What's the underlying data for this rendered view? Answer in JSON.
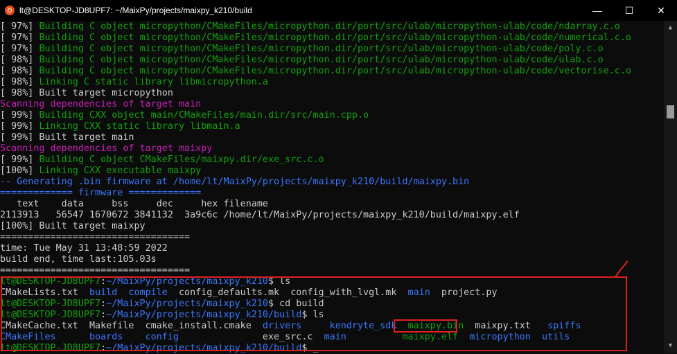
{
  "window": {
    "title": "lt@DESKTOP-JD8UPF7: ~/MaixPy/projects/maixpy_k210/build",
    "minimize": "—",
    "maximize": "☐",
    "close": "✕"
  },
  "colors": {
    "green": "#13a10e",
    "magenta": "#c71fb6",
    "blue": "#3b78ff",
    "white": "#cccccc",
    "highlight": "#e0201c"
  },
  "lines": [
    [
      {
        "t": "[ 97%] ",
        "c": "w"
      },
      {
        "t": "Building C object micropython/CMakeFiles/micropython.dir/port/src/ulab/micropython-ulab/code/ndarray.c.o",
        "c": "g"
      }
    ],
    [
      {
        "t": "[ 97%] ",
        "c": "w"
      },
      {
        "t": "Building C object micropython/CMakeFiles/micropython.dir/port/src/ulab/micropython-ulab/code/numerical.c.o",
        "c": "g"
      }
    ],
    [
      {
        "t": "[ 97%] ",
        "c": "w"
      },
      {
        "t": "Building C object micropython/CMakeFiles/micropython.dir/port/src/ulab/micropython-ulab/code/poly.c.o",
        "c": "g"
      }
    ],
    [
      {
        "t": "[ 98%] ",
        "c": "w"
      },
      {
        "t": "Building C object micropython/CMakeFiles/micropython.dir/port/src/ulab/micropython-ulab/code/ulab.c.o",
        "c": "g"
      }
    ],
    [
      {
        "t": "[ 98%] ",
        "c": "w"
      },
      {
        "t": "Building C object micropython/CMakeFiles/micropython.dir/port/src/ulab/micropython-ulab/code/vectorise.c.o",
        "c": "g"
      }
    ],
    [
      {
        "t": "[ 98%] ",
        "c": "w"
      },
      {
        "t": "Linking C static library libmicropython.a",
        "c": "g"
      }
    ],
    [
      {
        "t": "[ 98%] Built target micropython",
        "c": "w"
      }
    ],
    [
      {
        "t": "Scanning dependencies of target main",
        "c": "m"
      }
    ],
    [
      {
        "t": "[ 99%] ",
        "c": "w"
      },
      {
        "t": "Building CXX object main/CMakeFiles/main.dir/src/main.cpp.o",
        "c": "g"
      }
    ],
    [
      {
        "t": "[ 99%] ",
        "c": "w"
      },
      {
        "t": "Linking CXX static library libmain.a",
        "c": "g"
      }
    ],
    [
      {
        "t": "[ 99%] Built target main",
        "c": "w"
      }
    ],
    [
      {
        "t": "Scanning dependencies of target maixpy",
        "c": "m"
      }
    ],
    [
      {
        "t": "[ 99%] ",
        "c": "w"
      },
      {
        "t": "Building C object CMakeFiles/maixpy.dir/exe_src.c.o",
        "c": "g"
      }
    ],
    [
      {
        "t": "[100%] ",
        "c": "w"
      },
      {
        "t": "Linking CXX executable maixpy",
        "c": "g"
      }
    ],
    [
      {
        "t": "-- Generating .bin firmware at /home/lt/MaixPy/projects/maixpy_k210/build/maixpy.bin",
        "c": "b"
      }
    ],
    [
      {
        "t": "============= firmware =============",
        "c": "b"
      }
    ],
    [
      {
        "t": "   text    data     bss     dec     hex filename",
        "c": "w"
      }
    ],
    [
      {
        "t": "2113913   56547 1670672 3841132  3a9c6c /home/lt/MaixPy/projects/maixpy_k210/build/maixpy.elf",
        "c": "w"
      }
    ],
    [
      {
        "t": "[100%] Built target maixpy",
        "c": "w"
      }
    ],
    [
      {
        "t": "==================================",
        "c": "w"
      }
    ],
    [
      {
        "t": "time: Tue May 31 13:48:59 2022",
        "c": "w"
      }
    ],
    [
      {
        "t": "build end, time last:105.03s",
        "c": "w"
      }
    ],
    [
      {
        "t": "==================================",
        "c": "w"
      }
    ],
    [
      {
        "t": "lt@DESKTOP-JD8UPF7",
        "c": "g"
      },
      {
        "t": ":",
        "c": "w"
      },
      {
        "t": "~/MaixPy/projects/maixpy_k210",
        "c": "b"
      },
      {
        "t": "$ ls",
        "c": "w"
      }
    ],
    [
      {
        "t": "CMakeLists.txt  ",
        "c": "w"
      },
      {
        "t": "build",
        "c": "b"
      },
      {
        "t": "  ",
        "c": "w"
      },
      {
        "t": "compile",
        "c": "b"
      },
      {
        "t": "  config_defaults.mk  config_with_lvgl.mk  ",
        "c": "w"
      },
      {
        "t": "main",
        "c": "b"
      },
      {
        "t": "  project.py",
        "c": "w"
      }
    ],
    [
      {
        "t": "lt@DESKTOP-JD8UPF7",
        "c": "g"
      },
      {
        "t": ":",
        "c": "w"
      },
      {
        "t": "~/MaixPy/projects/maixpy_k210",
        "c": "b"
      },
      {
        "t": "$ cd build",
        "c": "w"
      }
    ],
    [
      {
        "t": "lt@DESKTOP-JD8UPF7",
        "c": "g"
      },
      {
        "t": ":",
        "c": "w"
      },
      {
        "t": "~/MaixPy/projects/maixpy_k210/build",
        "c": "b"
      },
      {
        "t": "$ ls",
        "c": "w"
      }
    ],
    [
      {
        "t": "CMakeCache.txt  Makefile  cmake_install.cmake  ",
        "c": "w"
      },
      {
        "t": "drivers",
        "c": "b"
      },
      {
        "t": "     ",
        "c": "w"
      },
      {
        "t": "kendryte_sdk",
        "c": "b"
      },
      {
        "t": "  ",
        "c": "w"
      },
      {
        "t": "maixpy.bin",
        "c": "g"
      },
      {
        "t": "  maixpy.txt   ",
        "c": "w"
      },
      {
        "t": "spiffs",
        "c": "b"
      }
    ],
    [
      {
        "t": "CMakeFiles",
        "c": "b"
      },
      {
        "t": "      ",
        "c": "w"
      },
      {
        "t": "boards",
        "c": "b"
      },
      {
        "t": "    ",
        "c": "w"
      },
      {
        "t": "config",
        "c": "b"
      },
      {
        "t": "               exe_src.c  ",
        "c": "w"
      },
      {
        "t": "main",
        "c": "b"
      },
      {
        "t": "          ",
        "c": "w"
      },
      {
        "t": "maixpy.elf",
        "c": "g"
      },
      {
        "t": "  ",
        "c": "w"
      },
      {
        "t": "micropython",
        "c": "b"
      },
      {
        "t": "  ",
        "c": "w"
      },
      {
        "t": "utils",
        "c": "b"
      }
    ],
    [
      {
        "t": "lt@DESKTOP-JD8UPF7",
        "c": "g"
      },
      {
        "t": ":",
        "c": "w"
      },
      {
        "t": "~/MaixPy/projects/maixpy_k210/build",
        "c": "b"
      },
      {
        "t": "$ ",
        "c": "w"
      },
      {
        "t": "_",
        "c": "w"
      }
    ]
  ]
}
